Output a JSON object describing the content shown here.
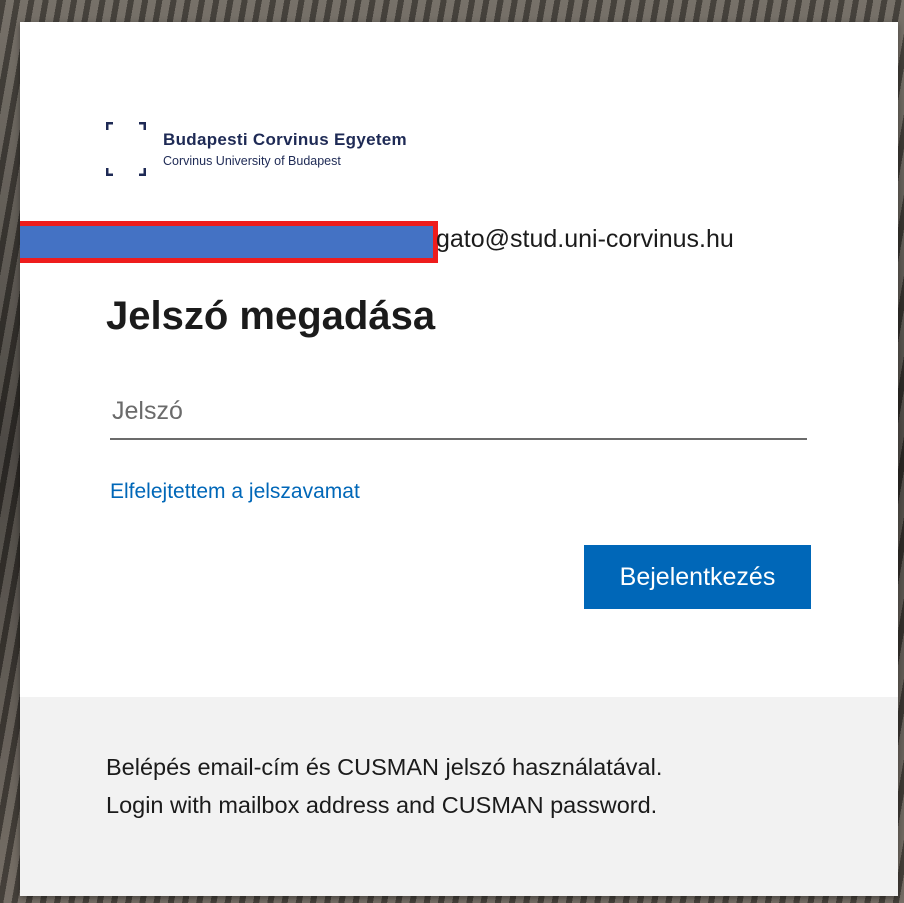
{
  "brand": {
    "name": "Budapesti Corvinus Egyetem",
    "subtitle": "Corvinus University of Budapest",
    "colors": {
      "navy": "#1e2a55"
    }
  },
  "identity": {
    "email_visible": "gato@stud.uni-corvinus.hu",
    "redaction": {
      "fill": "#4472c4",
      "border": "#ee1c1c"
    }
  },
  "page": {
    "heading": "Jelszó megadása"
  },
  "password": {
    "placeholder": "Jelszó",
    "value": ""
  },
  "links": {
    "forgot": "Elfelejtettem a jelszavamat"
  },
  "actions": {
    "signin": "Bejelentkezés"
  },
  "footer": {
    "line_hu": "Belépés email-cím és CUSMAN jelszó használatával.",
    "line_en": "Login with mailbox address and CUSMAN password."
  },
  "colors": {
    "accent": "#0067b8",
    "text": "#1b1b1b",
    "footer_bg": "#f2f2f2"
  }
}
